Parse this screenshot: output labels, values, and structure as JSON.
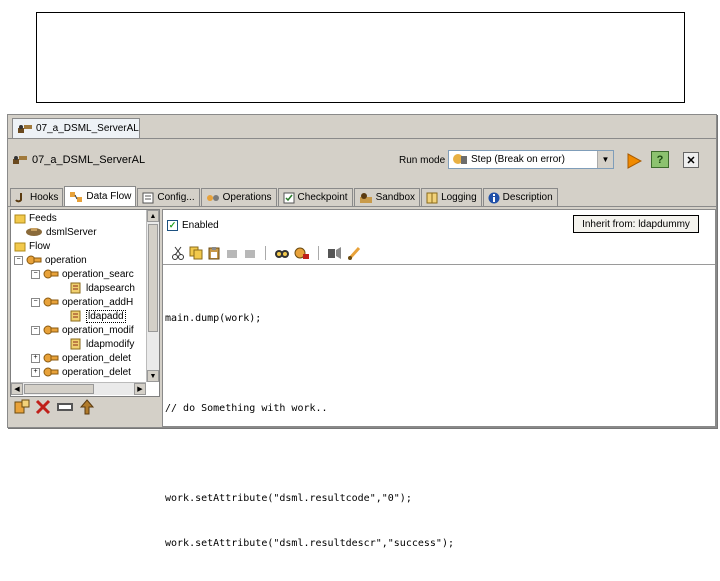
{
  "document_tab": {
    "label": "07_a_DSML_ServerAL"
  },
  "header": {
    "title": "07_a_DSML_ServerAL"
  },
  "run_mode": {
    "label": "Run mode",
    "value": "Step (Break on error)"
  },
  "tabs": [
    {
      "label": "Hooks",
      "icon": "hook-icon"
    },
    {
      "label": "Data Flow",
      "icon": "dataflow-icon",
      "active": true
    },
    {
      "label": "Config...",
      "icon": "config-icon"
    },
    {
      "label": "Operations",
      "icon": "operations-icon"
    },
    {
      "label": "Checkpoint",
      "icon": "checkpoint-icon"
    },
    {
      "label": "Sandbox",
      "icon": "sandbox-icon"
    },
    {
      "label": "Logging",
      "icon": "logging-icon"
    },
    {
      "label": "Description",
      "icon": "info-icon"
    }
  ],
  "tree": {
    "feeds": "Feeds",
    "dsml_server": "dsmlServer",
    "flow": "Flow",
    "operation": "operation",
    "op_search": "operation_searc",
    "ldapsearch": "ldapsearch",
    "op_add": "operation_addH",
    "ldapadd": "ldapadd",
    "op_modify": "operation_modif",
    "ldapmodify": "ldapmodify",
    "op_delete": "operation_delet",
    "op_delete2": "operation_delet"
  },
  "enabled_label": "Enabled",
  "inherit_button": "Inherit from: ldapdummy",
  "code_lines": [
    "main.dump(work);",
    "",
    "// do Something with work..",
    "",
    "work.setAttribute(\"dsml.resultcode\",\"0\");",
    "work.setAttribute(\"dsml.resultdescr\",\"success\");"
  ],
  "colors": {
    "accent": "#f5a000",
    "play": "#f08a00",
    "help": "#8cc26f",
    "panel": "#d4d0c8"
  }
}
